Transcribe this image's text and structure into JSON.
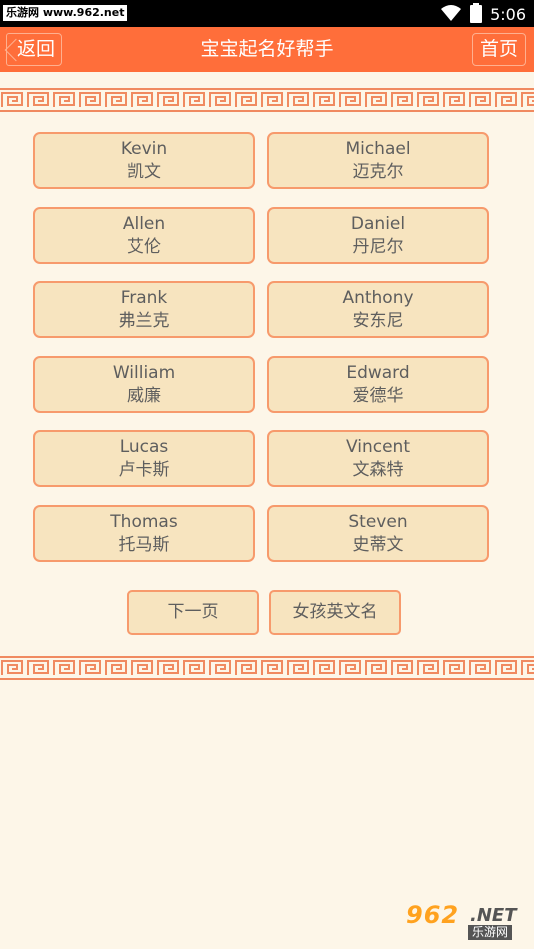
{
  "status_bar": {
    "watermark": "乐游网 www.962.net",
    "time": "5:06",
    "icons": [
      "wifi-icon",
      "battery-icon"
    ]
  },
  "app_bar": {
    "back_label": "返回",
    "title": "宝宝起名好帮手",
    "home_label": "首页"
  },
  "names": [
    {
      "en": "Kevin",
      "cn": "凯文"
    },
    {
      "en": "Michael",
      "cn": "迈克尔"
    },
    {
      "en": "Allen",
      "cn": "艾伦"
    },
    {
      "en": "Daniel",
      "cn": "丹尼尔"
    },
    {
      "en": "Frank",
      "cn": "弗兰克"
    },
    {
      "en": "Anthony",
      "cn": "安东尼"
    },
    {
      "en": "William",
      "cn": "威廉"
    },
    {
      "en": "Edward",
      "cn": "爱德华"
    },
    {
      "en": "Lucas",
      "cn": "卢卡斯"
    },
    {
      "en": "Vincent",
      "cn": "文森特"
    },
    {
      "en": "Thomas",
      "cn": "托马斯"
    },
    {
      "en": "Steven",
      "cn": "史蒂文"
    }
  ],
  "actions": {
    "next_page": "下一页",
    "girl_names": "女孩英文名"
  },
  "footer_logo": {
    "number": "962",
    "suffix": ".NET",
    "cn": "乐游网"
  },
  "colors": {
    "app_bar": "#ff6e3a",
    "background": "#fdf6e8",
    "button_fill": "#f7e4bf",
    "button_border": "#f79a6c",
    "fret_pattern": "#f08a60"
  }
}
